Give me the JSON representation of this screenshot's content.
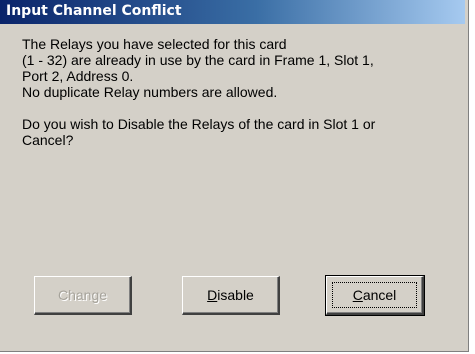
{
  "window": {
    "title": "Input Channel Conflict"
  },
  "message": {
    "lines": [
      "The Relays you have selected for this card",
      "(1 - 32) are already in use by the card in Frame 1, Slot 1,",
      "Port 2, Address 0.",
      "No duplicate Relay numbers are allowed."
    ],
    "question_lines": [
      "Do you wish to Disable the Relays of the card in Slot 1 or",
      "Cancel?"
    ]
  },
  "buttons": {
    "change": {
      "label": "Change",
      "state": "disabled"
    },
    "disable": {
      "mnemonic": "D",
      "label_rest": "isable"
    },
    "cancel": {
      "mnemonic": "C",
      "label_rest": "ancel",
      "state": "focused"
    }
  },
  "colors": {
    "dialog_face": "#d4d0c8",
    "titlebar_start": "#0a246a",
    "titlebar_end": "#a6caf0",
    "title_text": "#ffffff",
    "disabled_text": "#a6a39b"
  }
}
